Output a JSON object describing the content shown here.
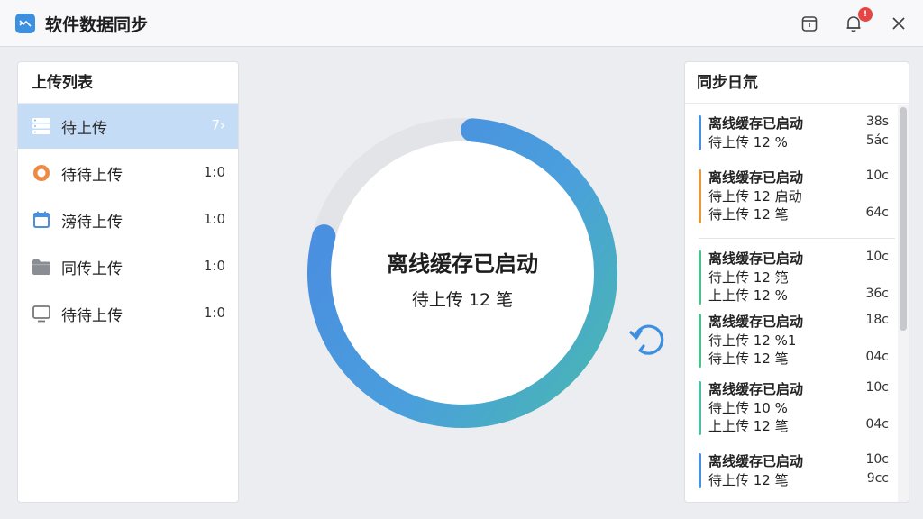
{
  "window": {
    "title": "软件数据同步",
    "notification_badge": "!"
  },
  "upload_panel": {
    "title": "上传列表",
    "items": [
      {
        "label": "待上传",
        "count": "7›",
        "icon": "server-icon"
      },
      {
        "label": "待待上传",
        "count": "1:0",
        "icon": "orange-circle-icon"
      },
      {
        "label": "滂待上传",
        "count": "1:0",
        "icon": "calendar-icon"
      },
      {
        "label": "同传上传",
        "count": "1:0",
        "icon": "folder-icon"
      },
      {
        "label": "待待上传",
        "count": "1:0",
        "icon": "monitor-icon"
      }
    ]
  },
  "status": {
    "title": "离线缓存已启动",
    "subtitle": "待上传 12 笔",
    "progress_fraction": 0.78
  },
  "log_panel": {
    "title": "同步日氘",
    "groups": [
      {
        "lines": [
          "离线缓存已启动",
          "待上传 12 %"
        ],
        "times": [
          "38s",
          "5ác"
        ],
        "color": "#4a8fe0"
      },
      {
        "lines": [
          "离线缓存已启动",
          "待上传 12 启动",
          "待上传 12 笔"
        ],
        "times": [
          "10c",
          "",
          "64c"
        ],
        "color": "#e5973f"
      },
      {
        "lines": [
          "离线缓存已启动",
          "待上传 12 笵",
          "上上传 12 %"
        ],
        "times": [
          "10c",
          "",
          "36c"
        ],
        "color": "#4cbf8a"
      },
      {
        "lines": [
          "离线缓存已启动",
          "待上传 12 %1",
          "待上传 12 笔"
        ],
        "times": [
          "18c",
          "",
          "04c"
        ],
        "color": "#4cbf8a"
      },
      {
        "lines": [
          "离线缓存已启动",
          "待上传 10 %",
          "上上传 12 笔"
        ],
        "times": [
          "10c",
          "",
          "04c"
        ],
        "color": "#4cbfa0"
      },
      {
        "lines": [
          "离线缓存已启动",
          "待上传 12 笔"
        ],
        "times": [
          "10c",
          "9cc"
        ],
        "color": "#4a8fe0"
      }
    ]
  }
}
